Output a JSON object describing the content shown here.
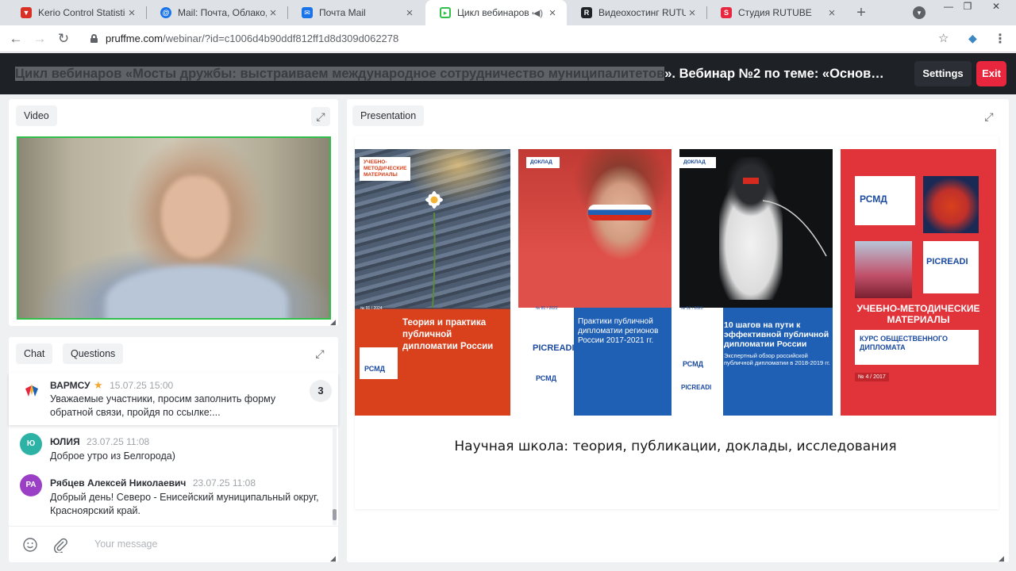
{
  "browser": {
    "tabs": [
      {
        "title": "Kerio Control Statistics",
        "favicon_color": "#d93025",
        "favicon_glyph": "shield-icon"
      },
      {
        "title": "Mail: Почта, Облако, К",
        "favicon_color": "#1a73e8",
        "favicon_glyph": "at-icon"
      },
      {
        "title": "Почта Mail",
        "favicon_color": "#1a73e8",
        "favicon_glyph": "mail-icon"
      },
      {
        "title": "Цикл вебинаров «",
        "favicon_color": "#2fbf4a",
        "favicon_glyph": "webinar-icon"
      },
      {
        "title": "Видеохостинг RUTUBE",
        "favicon_color": "#1e2126",
        "favicon_glyph": "rutube-icon"
      },
      {
        "title": "Студия RUTUBE",
        "favicon_color": "#e8263d",
        "favicon_glyph": "rutube-studio-icon"
      }
    ],
    "active_tab_index": 3,
    "url_domain": "pruffme.com",
    "url_path": "/webinar/?id=c1006d4b90ddf812ff1d8d309d062278"
  },
  "header": {
    "title_highlighted": "Цикл вебинаров «Мосты дружбы: выстраиваем международное сотрудничество муниципалитетов",
    "title_rest": "». Вебинар №2 по теме: «Основ…",
    "settings_label": "Settings",
    "exit_label": "Exit"
  },
  "video_panel": {
    "label": "Video"
  },
  "chat_panel": {
    "tabs": [
      {
        "label": "Chat",
        "active": true
      },
      {
        "label": "Questions",
        "active": false
      }
    ],
    "pinned": {
      "name": "ВАРМСУ",
      "time": "15.07.25 15:00",
      "text": "Уважаемые участники, просим заполнить форму обратной связи, пройдя по ссылке:...",
      "count": "3"
    },
    "messages": [
      {
        "initials": "Ю",
        "avatar_color": "#2cb3a6",
        "name": "ЮЛИЯ",
        "time": "23.07.25 11:08",
        "text": "Доброе утро из Белгорода)"
      },
      {
        "initials": "РА",
        "avatar_color": "#9b3fc7",
        "name": "Рябцев Алексей Николаевич",
        "time": "23.07.25 11:08",
        "text": "Добрый день! Северо - Енисейский муниципальный округ, Красноярский край."
      }
    ],
    "input_placeholder": "Your message"
  },
  "presentation_panel": {
    "label": "Presentation",
    "caption": "Научная школа: теория, публикации, доклады, исследования",
    "books": [
      {
        "label": "УЧЕБНО-МЕТОДИЧЕСКИЕ МАТЕРИАЛЫ",
        "title": "Теория и практика публичной дипломатии России",
        "issue": "№ 91 / 2024",
        "color": "#d9401c"
      },
      {
        "label": "ДОКЛАД",
        "title": "Практики публичной дипломатии регионов России 2017-2021 гг.",
        "issue": "№ 81 / 2022",
        "color": "#1f5fb4"
      },
      {
        "label": "ДОКЛАД",
        "title": "10 шагов на пути к эффективной публичной дипломатии России",
        "subtitle": "Экспертный обзор российской публичной дипломатии в 2018-2019 гг.",
        "issue": "№ 52 / 2020",
        "color": "#1f5fb4"
      },
      {
        "label": "РСМД",
        "title": "УЧЕБНО-МЕТОДИЧЕСКИЕ МАТЕРИАЛЫ",
        "subtitle": "КУРС ОБЩЕСТВЕННОГО ДИПЛОМАТА",
        "issue": "№ 4 / 2017",
        "color": "#e0333a"
      }
    ],
    "org_label": "РСМД",
    "picreadi_label": "PICREADI"
  }
}
